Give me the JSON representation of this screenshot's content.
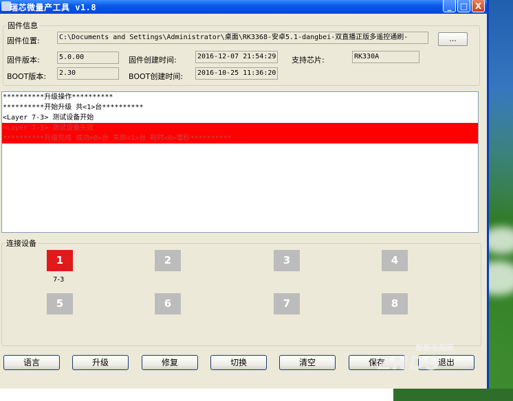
{
  "window": {
    "title": "瑞芯微量产工具 v1.8",
    "controls": {
      "minimize": "_",
      "maximize": "□",
      "close": "X"
    }
  },
  "firmware": {
    "group_label": "固件信息",
    "path_label": "固件位置:",
    "path_value": "C:\\Documents and Settings\\Administrator\\桌面\\RK3368-安卓5.1-dangbei-双直播正版多遥控通刷-",
    "browse_label": "...",
    "version_label": "固件版本:",
    "version_value": "5.0.00",
    "created_label": "固件创建时间:",
    "created_value": "2016-12-07 21:54:29",
    "chip_label": "支持芯片:",
    "chip_value": "RK330A",
    "boot_version_label": "BOOT版本:",
    "boot_version_value": "2.30",
    "boot_created_label": "BOOT创建时间:",
    "boot_created_value": "2016-10-25 11:36:20"
  },
  "log": {
    "lines": [
      {
        "text": "**********升级操作**********",
        "error": false
      },
      {
        "text": "**********开始升级 共<1>台**********",
        "error": false
      },
      {
        "text": "<Layer 7-3> 测试设备开始",
        "error": false
      },
      {
        "text": "<Layer 7-3> 测试设备失败",
        "error": true
      },
      {
        "text": "**********升级完成 成功<0>台 失败<1>台 耗时<0>毫秒**********",
        "error": true
      }
    ]
  },
  "devices": {
    "group_label": "连接设备",
    "slots": [
      {
        "label": "1",
        "sub": "7-3",
        "active": true
      },
      {
        "label": "2",
        "sub": "",
        "active": false
      },
      {
        "label": "3",
        "sub": "",
        "active": false
      },
      {
        "label": "4",
        "sub": "",
        "active": false
      },
      {
        "label": "5",
        "sub": "",
        "active": false
      },
      {
        "label": "6",
        "sub": "",
        "active": false
      },
      {
        "label": "7",
        "sub": "",
        "active": false
      },
      {
        "label": "8",
        "sub": "",
        "active": false
      }
    ]
  },
  "buttons": {
    "language": "语言",
    "upgrade": "升级",
    "repair": "修复",
    "switch": "切换",
    "clear": "清空",
    "save": "保存",
    "exit": "退出"
  },
  "watermark": {
    "top": "智能电视网",
    "big": "ZNDS",
    "com": ".com"
  },
  "colors": {
    "error_bg": "#ff0000",
    "active_device": "#e01a1a",
    "inactive_device": "#bcbcbc",
    "titlebar": "#0a5ae8"
  }
}
